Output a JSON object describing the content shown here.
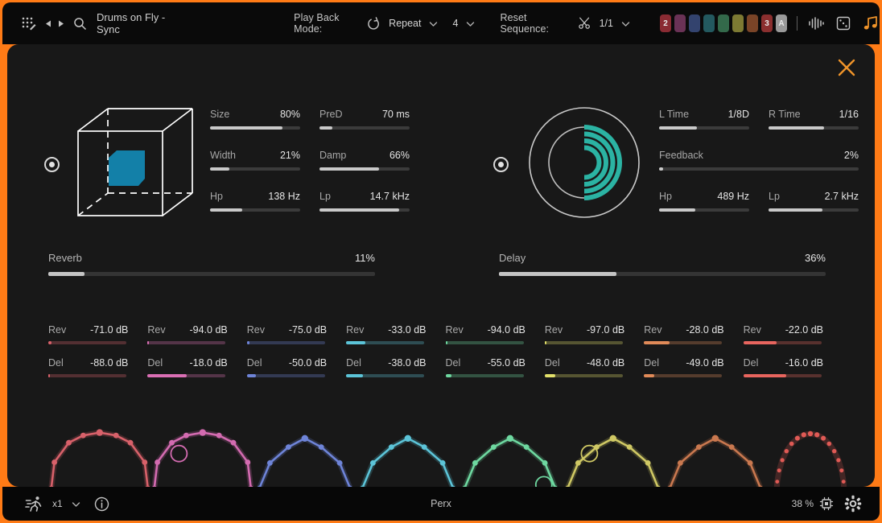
{
  "topbar": {
    "grid_icon": "grid-edit-icon",
    "prev_icon": "prev-arrow-icon",
    "next_icon": "next-arrow-icon",
    "search_icon": "search-icon",
    "title": "Drums on Fly - Sync",
    "playback_label": "Play Back Mode:",
    "repeat_icon": "repeat-loop-icon",
    "repeat_value": "Repeat",
    "repeat_chevron": "chevron-down-icon",
    "bars_value": "4",
    "bars_chevron": "chevron-down-icon",
    "reset_label": "Reset Sequence:",
    "scissors_icon": "scissors-icon",
    "reset_value": "1/1",
    "reset_chevron": "chevron-down-icon",
    "swatches": [
      {
        "color": "#8a2b33",
        "label": "2"
      },
      {
        "color": "#6a3256",
        "label": ""
      },
      {
        "color": "#33436e",
        "label": ""
      },
      {
        "color": "#23595f",
        "label": ""
      },
      {
        "color": "#33694a",
        "label": ""
      },
      {
        "color": "#7d7a33",
        "label": ""
      },
      {
        "color": "#7a4427",
        "label": ""
      },
      {
        "color": "#8b2f2f",
        "label": "3"
      },
      {
        "color": "#9a9a9a",
        "label": "A"
      }
    ],
    "waveform_icon": "waveform-icon",
    "dice_icon": "randomize-dice-icon",
    "note_icon": "music-note-icon",
    "accent_color": "#ff7b16"
  },
  "panel": {
    "close_icon": "close-icon",
    "close_color": "#f0942a"
  },
  "reverb": {
    "power_icon": "power-toggle-icon",
    "viz": "reverb-cube-icon",
    "viz_color": "#1380a8",
    "params": [
      {
        "name": "Size",
        "value": "80%",
        "pct": 80
      },
      {
        "name": "PreD",
        "value": "70 ms",
        "pct": 14
      },
      {
        "name": "Width",
        "value": "21%",
        "pct": 21
      },
      {
        "name": "Damp",
        "value": "66%",
        "pct": 66
      },
      {
        "name": "Hp",
        "value": "138 Hz",
        "pct": 36
      },
      {
        "name": "Lp",
        "value": "14.7 kHz",
        "pct": 88
      }
    ],
    "mix": {
      "name": "Reverb",
      "value": "11%",
      "pct": 11
    }
  },
  "delay": {
    "power_icon": "power-toggle-icon",
    "viz": "delay-rings-icon",
    "viz_color": "#2bb3a3",
    "params": [
      {
        "name": "L Time",
        "value": "1/8D",
        "pct": 42
      },
      {
        "name": "R Time",
        "value": "1/16",
        "pct": 62
      },
      {
        "name": "Feedback",
        "value": "2%",
        "pct": 2,
        "full": true
      },
      {
        "name": "Hp",
        "value": "489 Hz",
        "pct": 40
      },
      {
        "name": "Lp",
        "value": "2.7 kHz",
        "pct": 60
      }
    ],
    "mix": {
      "name": "Delay",
      "value": "36%",
      "pct": 36
    }
  },
  "sends": {
    "rev_label": "Rev",
    "del_label": "Del",
    "channels": [
      {
        "color": "#d8616a",
        "rev": "-71.0 dB",
        "rev_pct": 4,
        "del": "-88.0 dB",
        "del_pct": 2
      },
      {
        "color": "#da6fb4",
        "rev": "-94.0 dB",
        "rev_pct": 1,
        "del": "-18.0 dB",
        "del_pct": 50
      },
      {
        "color": "#6e84d8",
        "rev": "-75.0 dB",
        "rev_pct": 3,
        "del": "-50.0 dB",
        "del_pct": 12
      },
      {
        "color": "#5cc4d8",
        "rev": "-33.0 dB",
        "rev_pct": 25,
        "del": "-38.0 dB",
        "del_pct": 22
      },
      {
        "color": "#6ed8a0",
        "rev": "-94.0 dB",
        "rev_pct": 1,
        "del": "-55.0 dB",
        "del_pct": 8
      },
      {
        "color": "#e2e06a",
        "rev": "-97.0 dB",
        "rev_pct": 1,
        "del": "-48.0 dB",
        "del_pct": 14
      },
      {
        "color": "#e08a58",
        "rev": "-28.0 dB",
        "rev_pct": 33,
        "del": "-49.0 dB",
        "del_pct": 13
      },
      {
        "color": "#e8655e",
        "rev": "-22.0 dB",
        "rev_pct": 43,
        "del": "-16.0 dB",
        "del_pct": 55
      }
    ]
  },
  "envelopes": [
    {
      "color": "#d8616a",
      "shape": "dome",
      "ring": null
    },
    {
      "color": "#d36bb0",
      "shape": "dome",
      "ring": "left"
    },
    {
      "color": "#6e84d8",
      "shape": "trapezoid",
      "ring": null
    },
    {
      "color": "#5cc4d8",
      "shape": "trapezoid",
      "ring": null
    },
    {
      "color": "#6ed8a0",
      "shape": "trapezoid",
      "ring": "right"
    },
    {
      "color": "#cfc864",
      "shape": "trapezoid",
      "ring": "left"
    },
    {
      "color": "#c9784f",
      "shape": "trapezoid",
      "ring": null
    },
    {
      "color": "#e05a55",
      "shape": "dots",
      "ring": null
    }
  ],
  "footer": {
    "runner_icon": "runner-speed-icon",
    "speed_value": "x1",
    "speed_chevron": "chevron-down-icon",
    "info_icon": "info-icon",
    "preset_name": "Perx",
    "cpu_value": "38 %",
    "cpu_icon": "cpu-chip-icon",
    "settings_icon": "gear-icon"
  }
}
